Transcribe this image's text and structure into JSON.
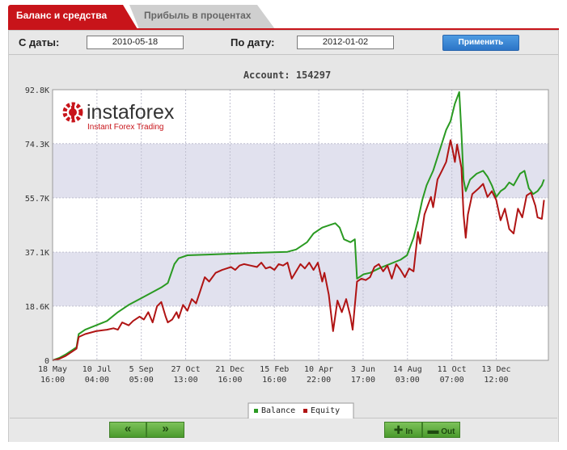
{
  "tabs": {
    "active": "Баланс и средства",
    "inactive": "Прибыль в процентах"
  },
  "filter": {
    "from_label": "С даты:",
    "from_value": "2010-05-18",
    "to_label": "По дату:",
    "to_value": "2012-01-02",
    "apply_label": "Применить"
  },
  "logo": {
    "name": "instaforex",
    "tagline": "Instant Forex Trading"
  },
  "footer": {
    "prev_label": "«",
    "next_label": "»",
    "in_label": "In",
    "out_label": "Out"
  },
  "chart_data": {
    "type": "line",
    "title": "Account: 154297",
    "ylim": [
      0,
      92800
    ],
    "y_ticks": [
      0,
      18600,
      37100,
      55700,
      74300,
      92800
    ],
    "y_tick_labels": [
      "0",
      "18.6K",
      "37.1K",
      "55.7K",
      "74.3K",
      "92.8K"
    ],
    "x_range": [
      0,
      228
    ],
    "x_ticks": [
      {
        "pos": 0,
        "line1": "18 May",
        "line2": "16:00"
      },
      {
        "pos": 20.4,
        "line1": "10 Jul",
        "line2": "04:00"
      },
      {
        "pos": 40.8,
        "line1": "5 Sep",
        "line2": "05:00"
      },
      {
        "pos": 61.2,
        "line1": "27 Oct",
        "line2": "13:00"
      },
      {
        "pos": 81.6,
        "line1": "21 Dec",
        "line2": "16:00"
      },
      {
        "pos": 102,
        "line1": "15 Feb",
        "line2": "16:00"
      },
      {
        "pos": 122.4,
        "line1": "10 Apr",
        "line2": "22:00"
      },
      {
        "pos": 142.8,
        "line1": "3 Jun",
        "line2": "17:00"
      },
      {
        "pos": 163.2,
        "line1": "14 Aug",
        "line2": "03:00"
      },
      {
        "pos": 183.6,
        "line1": "11 Oct",
        "line2": "07:00"
      },
      {
        "pos": 204,
        "line1": "13 Dec",
        "line2": "12:00"
      }
    ],
    "grid": true,
    "legend_position": "bottom-center",
    "series": [
      {
        "name": "Balance",
        "color": "#2a9a22",
        "points": [
          [
            0,
            0
          ],
          [
            3,
            800
          ],
          [
            6,
            2000
          ],
          [
            9,
            3500
          ],
          [
            11,
            4500
          ],
          [
            12,
            9000
          ],
          [
            15,
            10500
          ],
          [
            20,
            12000
          ],
          [
            25,
            13500
          ],
          [
            30,
            16500
          ],
          [
            35,
            19000
          ],
          [
            40,
            21000
          ],
          [
            45,
            23000
          ],
          [
            50,
            25000
          ],
          [
            53,
            26500
          ],
          [
            56,
            33000
          ],
          [
            58,
            35000
          ],
          [
            62,
            36000
          ],
          [
            70,
            36200
          ],
          [
            80,
            36500
          ],
          [
            90,
            36800
          ],
          [
            100,
            37000
          ],
          [
            108,
            37200
          ],
          [
            112,
            38000
          ],
          [
            117,
            40500
          ],
          [
            120,
            43500
          ],
          [
            124,
            45500
          ],
          [
            128,
            46500
          ],
          [
            130,
            47000
          ],
          [
            132,
            45500
          ],
          [
            134,
            41500
          ],
          [
            137,
            40500
          ],
          [
            138,
            41000
          ],
          [
            139,
            41500
          ],
          [
            140,
            28000
          ],
          [
            143,
            29500
          ],
          [
            146,
            30000
          ],
          [
            150,
            31500
          ],
          [
            155,
            33000
          ],
          [
            160,
            34500
          ],
          [
            163,
            36000
          ],
          [
            166,
            42000
          ],
          [
            168,
            48000
          ],
          [
            170,
            55000
          ],
          [
            172,
            60000
          ],
          [
            175,
            65000
          ],
          [
            178,
            72000
          ],
          [
            181,
            79000
          ],
          [
            183,
            82000
          ],
          [
            185,
            88000
          ],
          [
            187,
            92000
          ],
          [
            188,
            78000
          ],
          [
            189,
            62000
          ],
          [
            190,
            58000
          ],
          [
            192,
            62000
          ],
          [
            195,
            64000
          ],
          [
            198,
            65000
          ],
          [
            200,
            63000
          ],
          [
            202,
            60000
          ],
          [
            204,
            56000
          ],
          [
            206,
            58000
          ],
          [
            208,
            59000
          ],
          [
            210,
            61000
          ],
          [
            212,
            60000
          ],
          [
            215,
            64000
          ],
          [
            217,
            65000
          ],
          [
            219,
            59000
          ],
          [
            221,
            57000
          ],
          [
            223,
            58000
          ],
          [
            225,
            60000
          ],
          [
            226,
            62000
          ]
        ]
      },
      {
        "name": "Equity",
        "color": "#b01414",
        "points": [
          [
            0,
            0
          ],
          [
            3,
            500
          ],
          [
            6,
            1500
          ],
          [
            9,
            3000
          ],
          [
            11,
            4000
          ],
          [
            12,
            8000
          ],
          [
            15,
            9000
          ],
          [
            20,
            10000
          ],
          [
            25,
            10500
          ],
          [
            28,
            11000
          ],
          [
            30,
            10500
          ],
          [
            32,
            13000
          ],
          [
            35,
            12000
          ],
          [
            37,
            13500
          ],
          [
            40,
            15000
          ],
          [
            42,
            14000
          ],
          [
            44,
            16500
          ],
          [
            46,
            13000
          ],
          [
            48,
            18500
          ],
          [
            50,
            20000
          ],
          [
            52,
            15000
          ],
          [
            53,
            13000
          ],
          [
            55,
            14000
          ],
          [
            57,
            16500
          ],
          [
            58,
            14500
          ],
          [
            60,
            19000
          ],
          [
            62,
            17000
          ],
          [
            64,
            21000
          ],
          [
            66,
            19500
          ],
          [
            68,
            24000
          ],
          [
            70,
            28500
          ],
          [
            72,
            27000
          ],
          [
            75,
            30000
          ],
          [
            78,
            31000
          ],
          [
            80,
            31500
          ],
          [
            82,
            32000
          ],
          [
            84,
            31000
          ],
          [
            86,
            32500
          ],
          [
            88,
            33000
          ],
          [
            91,
            32500
          ],
          [
            94,
            32000
          ],
          [
            96,
            33500
          ],
          [
            98,
            31500
          ],
          [
            100,
            32000
          ],
          [
            102,
            31000
          ],
          [
            104,
            33000
          ],
          [
            106,
            32500
          ],
          [
            108,
            33500
          ],
          [
            110,
            28000
          ],
          [
            112,
            30500
          ],
          [
            114,
            33000
          ],
          [
            116,
            31500
          ],
          [
            118,
            33500
          ],
          [
            120,
            31000
          ],
          [
            122,
            33500
          ],
          [
            124,
            27000
          ],
          [
            125,
            30000
          ],
          [
            127,
            22500
          ],
          [
            129,
            10000
          ],
          [
            131,
            20500
          ],
          [
            133,
            16500
          ],
          [
            135,
            21000
          ],
          [
            137,
            15000
          ],
          [
            138,
            10500
          ],
          [
            140,
            27000
          ],
          [
            142,
            28000
          ],
          [
            144,
            27500
          ],
          [
            146,
            28500
          ],
          [
            148,
            32000
          ],
          [
            150,
            33000
          ],
          [
            152,
            30500
          ],
          [
            154,
            32500
          ],
          [
            156,
            28000
          ],
          [
            158,
            33000
          ],
          [
            160,
            31000
          ],
          [
            162,
            28500
          ],
          [
            164,
            31500
          ],
          [
            166,
            30500
          ],
          [
            168,
            44000
          ],
          [
            169,
            40000
          ],
          [
            171,
            50000
          ],
          [
            172,
            52000
          ],
          [
            174,
            56000
          ],
          [
            175,
            52500
          ],
          [
            177,
            62000
          ],
          [
            179,
            65000
          ],
          [
            181,
            68000
          ],
          [
            183,
            75500
          ],
          [
            184,
            72000
          ],
          [
            185,
            68000
          ],
          [
            186,
            74000
          ],
          [
            188,
            66000
          ],
          [
            189,
            50000
          ],
          [
            190,
            42000
          ],
          [
            191,
            50000
          ],
          [
            193,
            57000
          ],
          [
            196,
            59000
          ],
          [
            198,
            60500
          ],
          [
            200,
            56000
          ],
          [
            202,
            58000
          ],
          [
            204,
            55000
          ],
          [
            206,
            48000
          ],
          [
            208,
            52000
          ],
          [
            210,
            45000
          ],
          [
            212,
            43500
          ],
          [
            214,
            52000
          ],
          [
            216,
            49000
          ],
          [
            218,
            56500
          ],
          [
            220,
            57500
          ],
          [
            222,
            53000
          ],
          [
            223,
            49000
          ],
          [
            225,
            48500
          ],
          [
            226,
            55000
          ]
        ]
      }
    ]
  }
}
